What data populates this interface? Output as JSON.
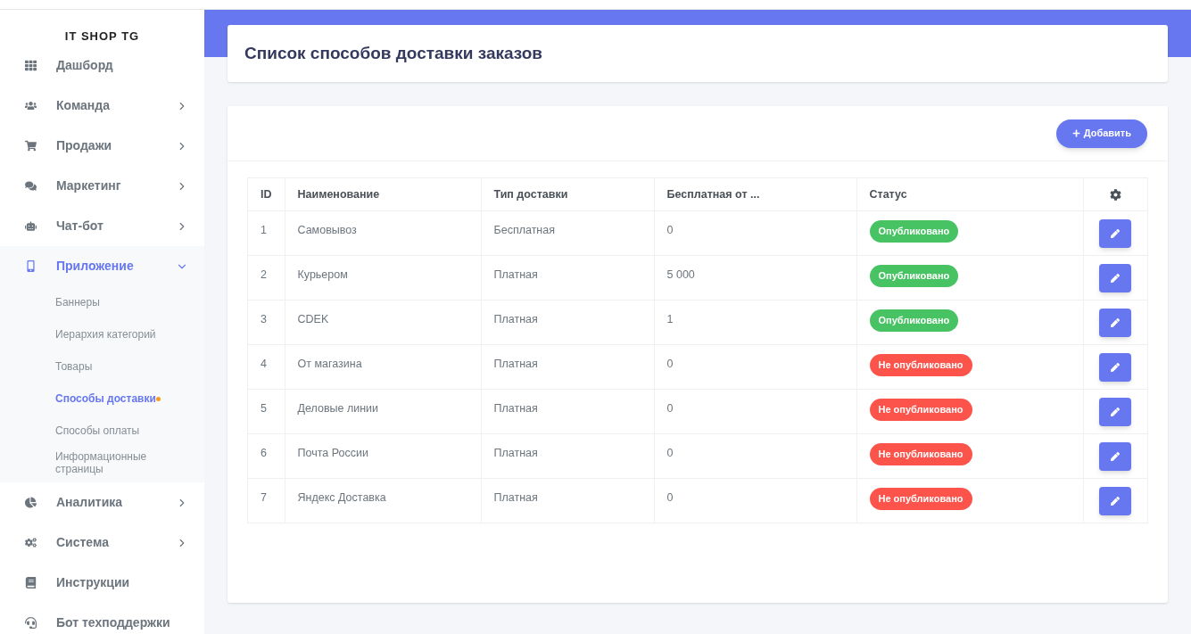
{
  "sidebar": {
    "brand": "IT SHOP TG",
    "items": [
      {
        "label": "Дашборд",
        "expandable": false,
        "expanded": false,
        "selected": false
      },
      {
        "label": "Команда",
        "expandable": true,
        "expanded": false,
        "selected": false
      },
      {
        "label": "Продажи",
        "expandable": true,
        "expanded": false,
        "selected": false
      },
      {
        "label": "Маркетинг",
        "expandable": true,
        "expanded": false,
        "selected": false
      },
      {
        "label": "Чат-бот",
        "expandable": true,
        "expanded": false,
        "selected": false
      },
      {
        "label": "Приложение",
        "expandable": true,
        "expanded": true,
        "selected": true,
        "children": [
          {
            "label": "Баннеры",
            "selected": false
          },
          {
            "label": "Иерархия категорий",
            "selected": false
          },
          {
            "label": "Товары",
            "selected": false
          },
          {
            "label": "Способы доставки",
            "selected": true
          },
          {
            "label": "Способы оплаты",
            "selected": false
          },
          {
            "label": "Информационные страницы",
            "selected": false
          }
        ]
      },
      {
        "label": "Аналитика",
        "expandable": true,
        "expanded": false,
        "selected": false
      },
      {
        "label": "Система",
        "expandable": true,
        "expanded": false,
        "selected": false
      },
      {
        "label": "Инструкции",
        "expandable": false,
        "expanded": false,
        "selected": false
      },
      {
        "label": "Бот техподдержки",
        "expandable": false,
        "expanded": false,
        "selected": false
      }
    ]
  },
  "page": {
    "title": "Список способов доставки заказов"
  },
  "toolbar": {
    "add_button": "Добавить"
  },
  "table": {
    "columns": [
      "ID",
      "Наименование",
      "Тип доставки",
      "Бесплатная от ...",
      "Статус"
    ],
    "rows": [
      {
        "id": "1",
        "name": "Самовывоз",
        "type": "Бесплатная",
        "free_from": "0",
        "status": "Опубликовано",
        "published": true
      },
      {
        "id": "2",
        "name": "Курьером",
        "type": "Платная",
        "free_from": "5 000",
        "status": "Опубликовано",
        "published": true
      },
      {
        "id": "3",
        "name": "CDEK",
        "type": "Платная",
        "free_from": "1",
        "status": "Опубликовано",
        "published": true
      },
      {
        "id": "4",
        "name": "От магазина",
        "type": "Платная",
        "free_from": "0",
        "status": "Не опубликовано",
        "published": false
      },
      {
        "id": "5",
        "name": "Деловые линии",
        "type": "Платная",
        "free_from": "0",
        "status": "Не опубликовано",
        "published": false
      },
      {
        "id": "6",
        "name": "Почта России",
        "type": "Платная",
        "free_from": "0",
        "status": "Не опубликовано",
        "published": false
      },
      {
        "id": "7",
        "name": "Яндекс Доставка",
        "type": "Платная",
        "free_from": "0",
        "status": "Не опубликовано",
        "published": false
      }
    ]
  }
}
